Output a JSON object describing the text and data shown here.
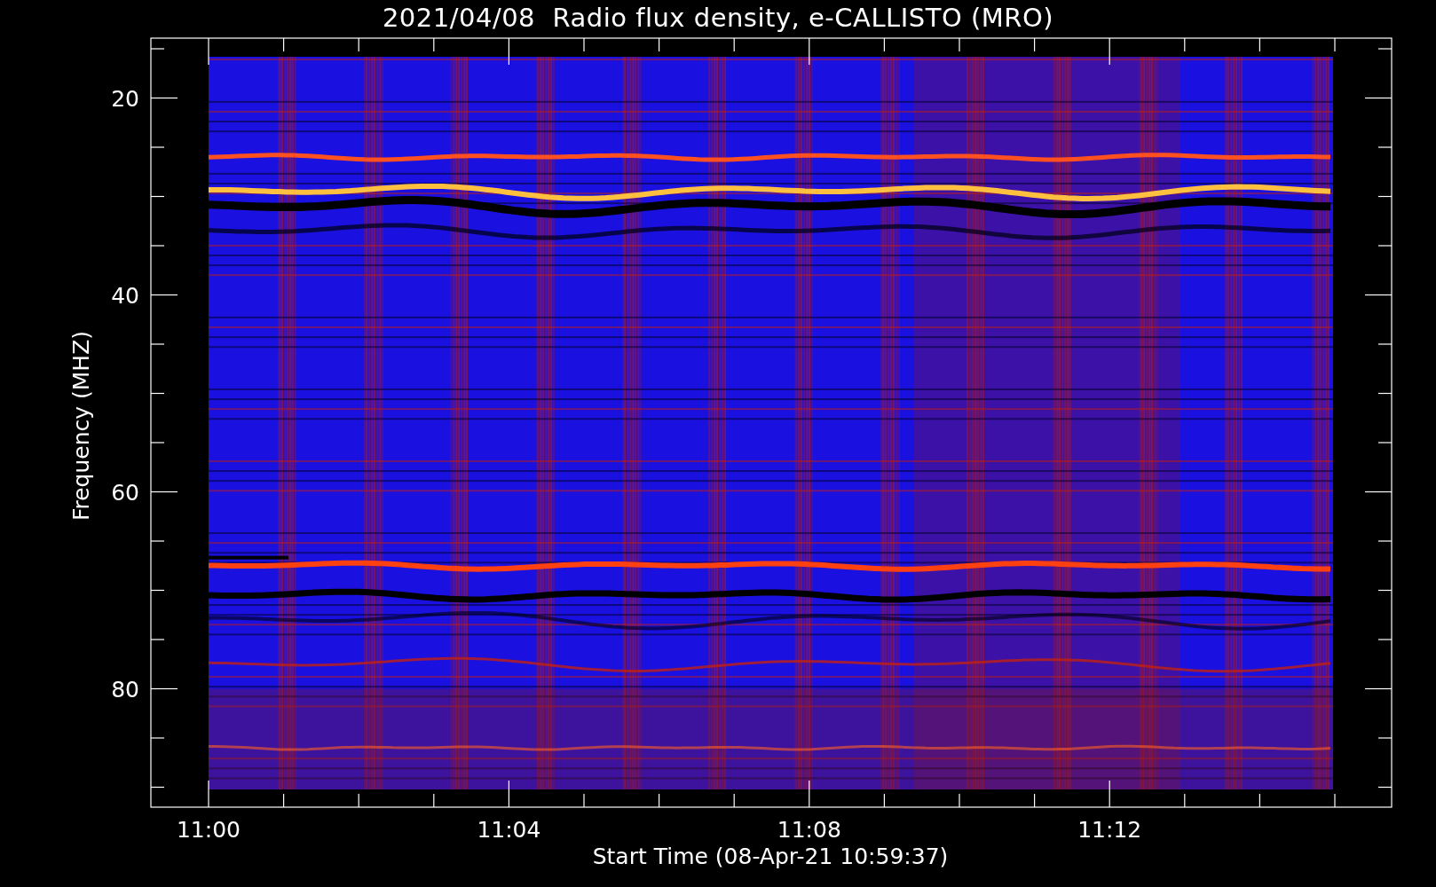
{
  "title": "2021/04/08  Radio flux density, e-CALLISTO (MRO)",
  "y_axis": {
    "label": "Frequency (MHZ)",
    "ticks": [
      "20",
      "40",
      "60",
      "80"
    ]
  },
  "x_axis": {
    "label": "Start Time (08-Apr-21 10:59:37)",
    "ticks": [
      "11:00",
      "11:04",
      "11:08",
      "11:12"
    ]
  }
}
